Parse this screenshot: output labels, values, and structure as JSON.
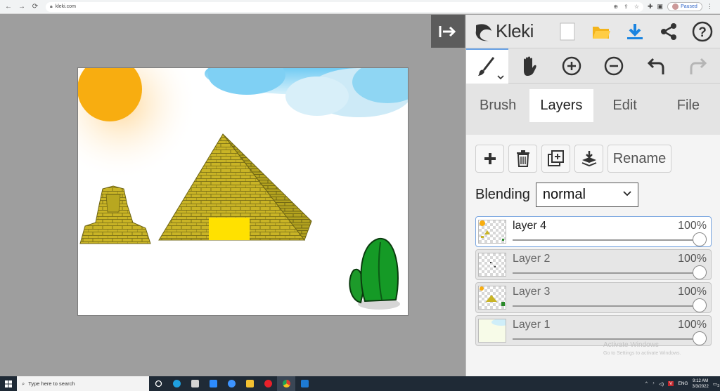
{
  "browser": {
    "url": "kleki.com",
    "profile_status": "Paused",
    "nav": [
      "back-icon",
      "forward-icon",
      "reload-icon"
    ]
  },
  "app": {
    "name": "Kleki",
    "collapse_icon": "collapse-panel-icon",
    "top_icons": [
      "new-image-icon",
      "open-folder-icon",
      "download-icon",
      "share-icon",
      "help-icon"
    ],
    "tools": [
      "brush-tool-icon",
      "hand-tool-icon",
      "zoom-in-icon",
      "zoom-out-icon",
      "undo-icon",
      "redo-icon"
    ],
    "tabs": [
      {
        "label": "Brush",
        "active": false
      },
      {
        "label": "Layers",
        "active": true
      },
      {
        "label": "Edit",
        "active": false
      },
      {
        "label": "File",
        "active": false
      }
    ],
    "layer_buttons": {
      "add": "add-layer-icon",
      "delete": "delete-layer-icon",
      "duplicate": "duplicate-layer-icon",
      "merge": "merge-down-icon",
      "rename_label": "Rename"
    },
    "blending": {
      "label": "Blending",
      "value": "normal"
    },
    "layers": [
      {
        "name": "layer 4",
        "opacity": "100%",
        "opacity_value": 1.0,
        "active": true
      },
      {
        "name": "Layer 2",
        "opacity": "100%",
        "opacity_value": 1.0,
        "active": false
      },
      {
        "name": "Layer 3",
        "opacity": "100%",
        "opacity_value": 1.0,
        "active": false
      },
      {
        "name": "Layer 1",
        "opacity": "100%",
        "opacity_value": 1.0,
        "active": false
      }
    ]
  },
  "watermark": {
    "line1": "Activate Windows",
    "line2": "Go to Settings to activate Windows."
  },
  "taskbar": {
    "search_placeholder": "Type here to search",
    "language": "ENG",
    "time": "9:12 AM",
    "date": "3/3/2022",
    "notification_count": "3"
  }
}
